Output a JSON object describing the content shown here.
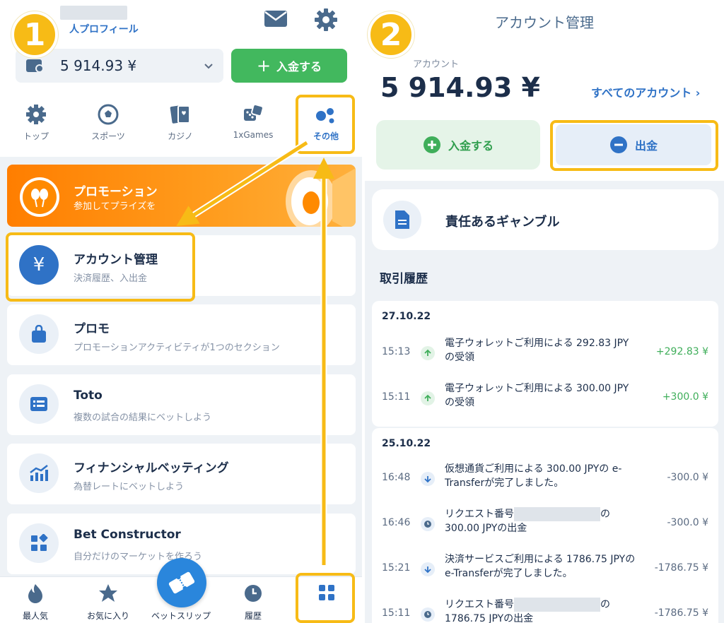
{
  "left": {
    "header": {
      "profile_link": "人プロフィール",
      "balance": "5 914.93 ¥",
      "deposit_label": "入金する"
    },
    "nav": [
      {
        "label": "トップ",
        "icon": "gear-top-icon"
      },
      {
        "label": "スポーツ",
        "icon": "soccer-ball-icon"
      },
      {
        "label": "カジノ",
        "icon": "cards-icon"
      },
      {
        "label": "1xGames",
        "icon": "dice-icon"
      },
      {
        "label": "その他",
        "icon": "dots-icon"
      }
    ],
    "promo": {
      "title": "プロモーション",
      "subtitle": "参加してプライズを"
    },
    "menu": [
      {
        "title": "アカウント管理",
        "subtitle": "決済履歴、入出金",
        "icon": "yen-icon"
      },
      {
        "title": "プロモ",
        "subtitle": "プロモーションアクティビティが1つのセクション",
        "icon": "bag-icon"
      },
      {
        "title": "Toto",
        "subtitle": "複数の試合の結果にベットしよう",
        "icon": "list-card-icon"
      },
      {
        "title": "フィナンシャルベッティング",
        "subtitle": "為替レートにベットしよう",
        "icon": "chart-icon"
      },
      {
        "title": "Bet Constructor",
        "subtitle": "自分だけのマーケットを作ろう",
        "icon": "blocks-icon"
      }
    ],
    "bottom_bar": [
      {
        "label": "最人気",
        "icon": "fire-icon"
      },
      {
        "label": "お気に入り",
        "icon": "star-icon"
      },
      {
        "label": "ベットスリップ",
        "icon": "ticket-icon"
      },
      {
        "label": "履歴",
        "icon": "clock-icon"
      },
      {
        "label": "",
        "icon": "grid-icon"
      }
    ],
    "step": "1"
  },
  "right": {
    "title": "アカウント管理",
    "account_label": "アカウント",
    "balance": "5 914.93 ¥",
    "all_accounts": "すべてのアカウント ›",
    "deposit_label": "入金する",
    "withdraw_label": "出金",
    "responsible": "責任あるギャンブル",
    "history_title": "取引履歴",
    "groups": [
      {
        "date": "27.10.22",
        "items": [
          {
            "time": "15:13",
            "desc": "電子ウォレットご利用による 292.83 JPYの受領",
            "amount": "+292.83 ¥"
          },
          {
            "time": "15:11",
            "desc": "電子ウォレットご利用による 300.00 JPYの受領",
            "amount": "+300.0 ¥"
          }
        ]
      },
      {
        "date": "25.10.22",
        "items": [
          {
            "time": "16:48",
            "desc": "仮想通貨ご利用による 300.00 JPYの e-Transferが完了しました。",
            "amount": "-300.0 ¥"
          },
          {
            "time": "16:46",
            "desc_prefix": "リクエスト番号",
            "desc_suffix": "の",
            "desc_line2": "300.00 JPYの出金",
            "amount": "-300.0 ¥"
          },
          {
            "time": "15:21",
            "desc": "決済サービスご利用による 1786.75 JPYのe-Transferが完了しました。",
            "amount": "-1786.75 ¥"
          },
          {
            "time": "15:11",
            "desc_prefix": "リクエスト番号",
            "desc_suffix": "の",
            "desc_line2": "1786.75 JPYの出金",
            "amount": "-1786.75 ¥"
          }
        ]
      }
    ],
    "step": "2"
  },
  "colors": {
    "accent_blue": "#2f72c6",
    "green": "#42b85e",
    "highlight": "#f7bb16",
    "orange": "#ff8a00"
  }
}
